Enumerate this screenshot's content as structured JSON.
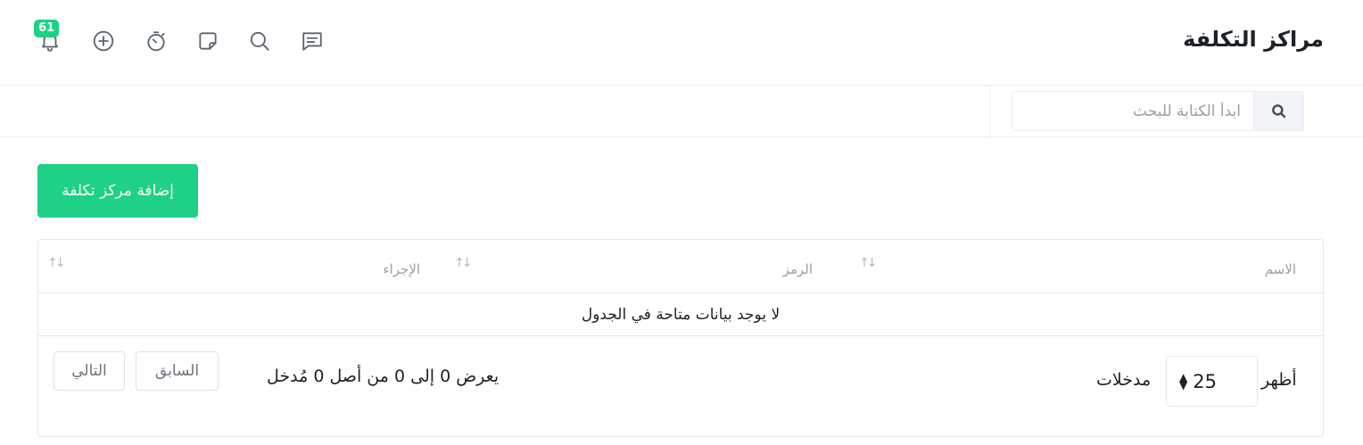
{
  "header": {
    "title": "مراكز التكلفة",
    "notification_count": "61",
    "icons": [
      "bell-icon",
      "plus-circle-icon",
      "timer-icon",
      "sticky-note-icon",
      "search-icon",
      "message-icon"
    ]
  },
  "search": {
    "placeholder": "ابدأ الكتابة للبحث",
    "value": ""
  },
  "toolbar": {
    "add_label": "إضافة مركز تكلفة"
  },
  "table": {
    "columns": [
      "الاسم",
      "الرمز",
      "الإجراء"
    ],
    "empty_message": "لا يوجد بيانات متاحة في الجدول"
  },
  "footer": {
    "show_label": "أظهر",
    "page_length": "25",
    "entries_label": "مدخلات",
    "info": "يعرض 0 إلى 0 من أصل 0 مُدخل",
    "previous_label": "السابق",
    "next_label": "التالي"
  },
  "colors": {
    "accent": "#1ed186",
    "border": "#e3e8ec",
    "muted_text": "#99a0a8"
  }
}
